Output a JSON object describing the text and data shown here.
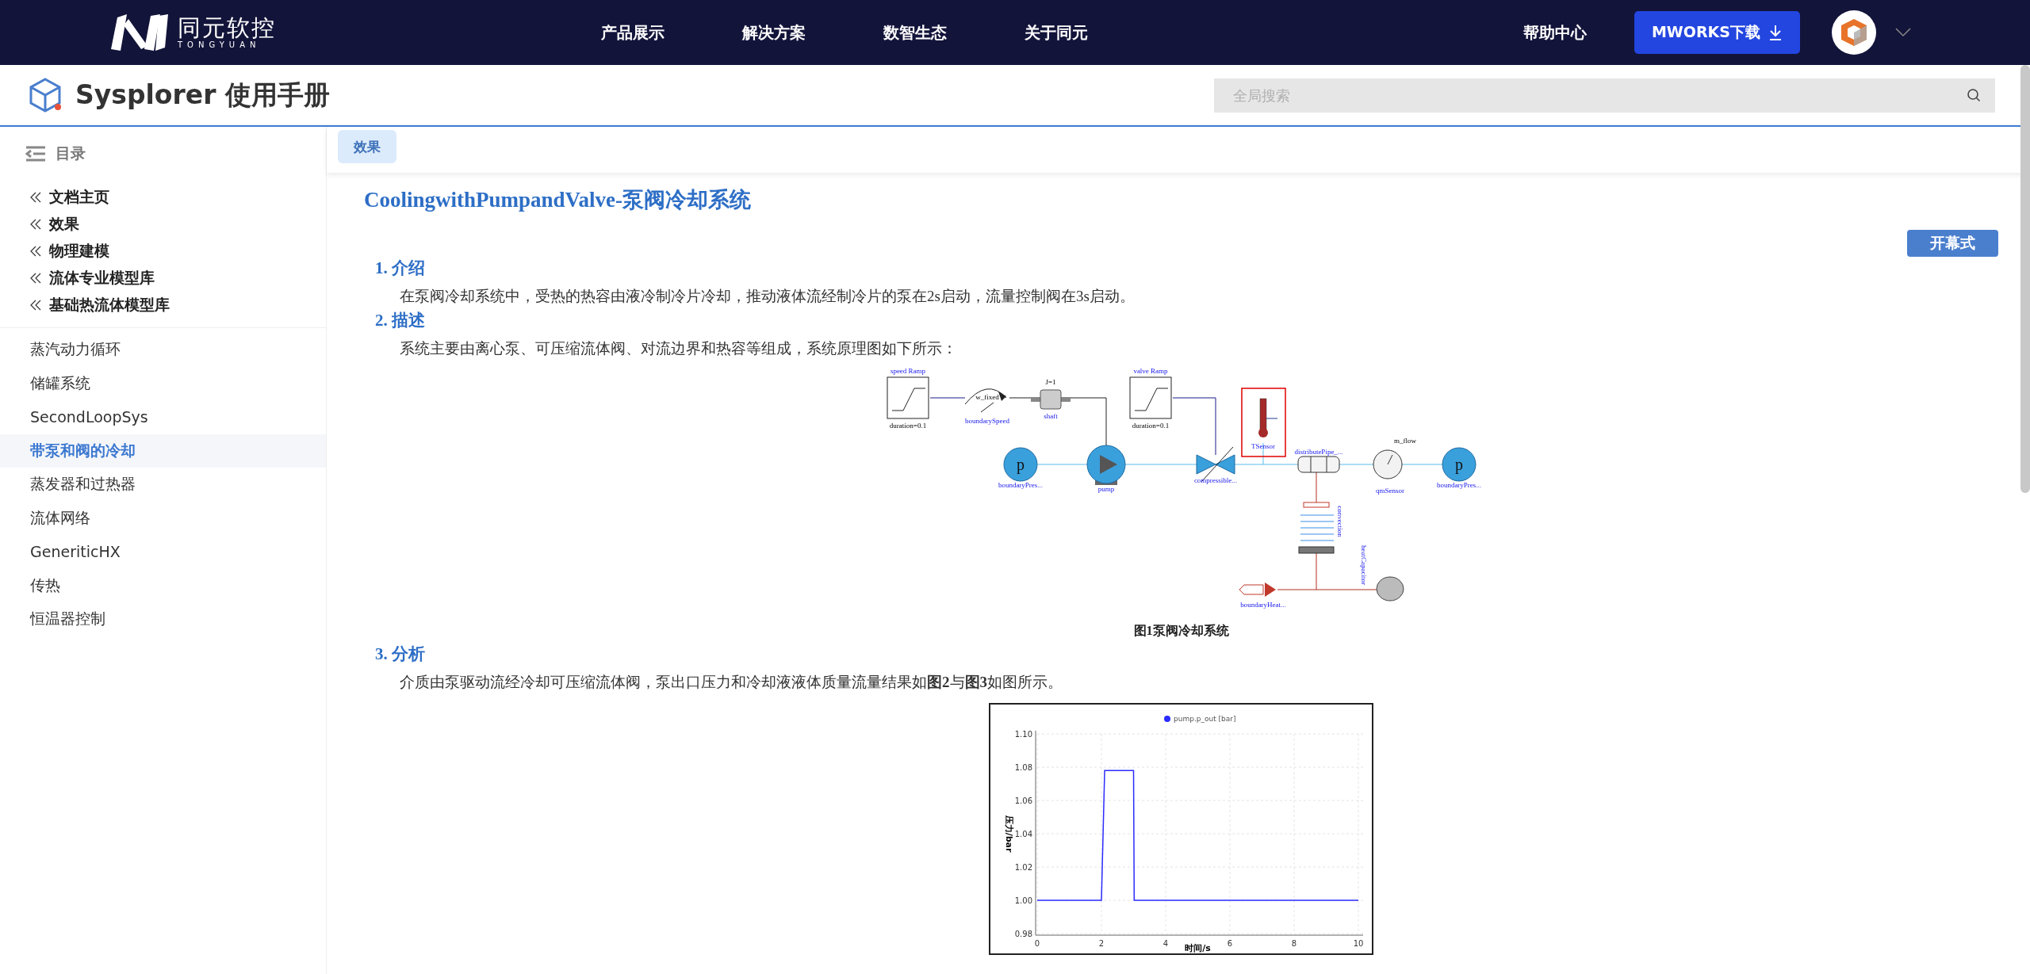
{
  "header": {
    "logo_text": "同元软控",
    "logo_subtext": "TONGYUAN",
    "nav": [
      "产品展示",
      "解决方案",
      "数智生态",
      "关于同元"
    ],
    "help": "帮助中心",
    "download_button": "MWORKS下载"
  },
  "subheader": {
    "title": "Sysplorer 使用手册",
    "search": {
      "placeholder": "全局搜索"
    }
  },
  "sidebar": {
    "title": "目录",
    "breadcrumbs": [
      "文档主页",
      "效果",
      "物理建模",
      "流体专业模型库",
      "基础热流体模型库"
    ],
    "items": [
      {
        "label": "蒸汽动力循环",
        "selected": false
      },
      {
        "label": "储罐系统",
        "selected": false
      },
      {
        "label": "SecondLoopSys",
        "selected": false
      },
      {
        "label": "带泵和阀的冷却",
        "selected": true
      },
      {
        "label": "蒸发器和过热器",
        "selected": false
      },
      {
        "label": "流体网络",
        "selected": false
      },
      {
        "label": "GeneriticHX",
        "selected": false
      },
      {
        "label": "传热",
        "selected": false
      },
      {
        "label": "恒温器控制",
        "selected": false
      }
    ]
  },
  "tab": "效果",
  "article": {
    "title": "CoolingwithPumpandValve-泵阀冷却系统",
    "side_button": "开幕式",
    "sections": [
      {
        "number": "1.",
        "heading": "介绍",
        "text": "在泵阀冷却系统中，受热的热容由液冷制冷片冷却，推动液体流经制冷片的泵在2s启动，流量控制阀在3s启动。"
      },
      {
        "number": "2.",
        "heading": "描述",
        "text": "系统主要由离心泵、可压缩流体阀、对流边界和热容等组成，系统原理图如下所示："
      },
      {
        "number": "3.",
        "heading": "分析",
        "text": "介质由泵驱动流经冷却可压缩流体阀，泵出口压力和冷却液液体质量流量结果如**图2**与**图3**如图所示。"
      }
    ],
    "diagram": {
      "caption": "图1泵阀冷却系统",
      "blocks": [
        {
          "kind": "ramp",
          "label": "speed Ramp",
          "param": "duration=0.1"
        },
        {
          "kind": "speed",
          "label": "boundarySpeed",
          "param": "w_fixed"
        },
        {
          "kind": "shaft",
          "label": "shaft",
          "param": "J=1"
        },
        {
          "kind": "ramp",
          "label": "valve Ramp",
          "param": "duration=0.1"
        },
        {
          "kind": "tsensor",
          "label": "TSensor"
        },
        {
          "kind": "boundary",
          "label": "boundaryPres...",
          "symbol": "p"
        },
        {
          "kind": "pump",
          "label": "pump"
        },
        {
          "kind": "valve",
          "label": "compressible..."
        },
        {
          "kind": "pipe",
          "label": "distributePipe_..."
        },
        {
          "kind": "flowsensor",
          "label": "qmSensor",
          "param": "m_flow"
        },
        {
          "kind": "boundary",
          "label": "boundaryPres...",
          "symbol": "p"
        },
        {
          "kind": "convection",
          "label": "convection"
        },
        {
          "kind": "heatsource",
          "label": "boundaryHeat..."
        },
        {
          "kind": "capacitor",
          "label": "heatCapacitor"
        }
      ]
    },
    "chart_data": {
      "type": "line",
      "grid": true,
      "xlabel": "时间/s",
      "ylabel": "压力/bar",
      "x": [
        0,
        2,
        2.1,
        3,
        3.02,
        10
      ],
      "series": [
        {
          "name": "pump.p_out [bar]",
          "color": "#2b2bff",
          "values": [
            1.0,
            1.0,
            1.078,
            1.078,
            1.0,
            1.0
          ]
        }
      ],
      "xlim": [
        0,
        10
      ],
      "ylim": [
        0.98,
        1.1
      ],
      "xticks": [
        0,
        2,
        4,
        6,
        8,
        10
      ],
      "yticks": [
        {
          "value": 0.98,
          "label": "0.98"
        },
        {
          "value": 1.0,
          "label": "1.00"
        },
        {
          "value": 1.02,
          "label": "1.02"
        },
        {
          "value": 1.04,
          "label": "1.04"
        },
        {
          "value": 1.06,
          "label": "1.06"
        },
        {
          "value": 1.08,
          "label": "1.08"
        },
        {
          "value": 1.1,
          "label": "1.10"
        }
      ]
    }
  }
}
